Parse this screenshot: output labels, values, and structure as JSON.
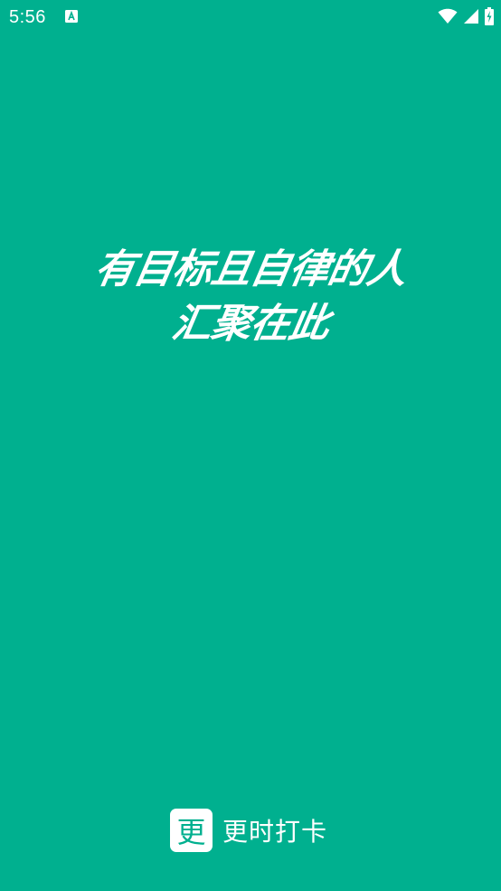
{
  "status_bar": {
    "time": "5:56",
    "icons": [
      "text-notification-icon",
      "wifi-icon",
      "cellular-signal-icon",
      "battery-charging-icon"
    ]
  },
  "splash": {
    "slogan_line_1": "有目标且自律的人",
    "slogan_line_2": "汇聚在此"
  },
  "brand": {
    "logo_char": "更",
    "name": "更时打卡"
  },
  "colors": {
    "background": "#00b08f",
    "foreground": "#ffffff"
  }
}
